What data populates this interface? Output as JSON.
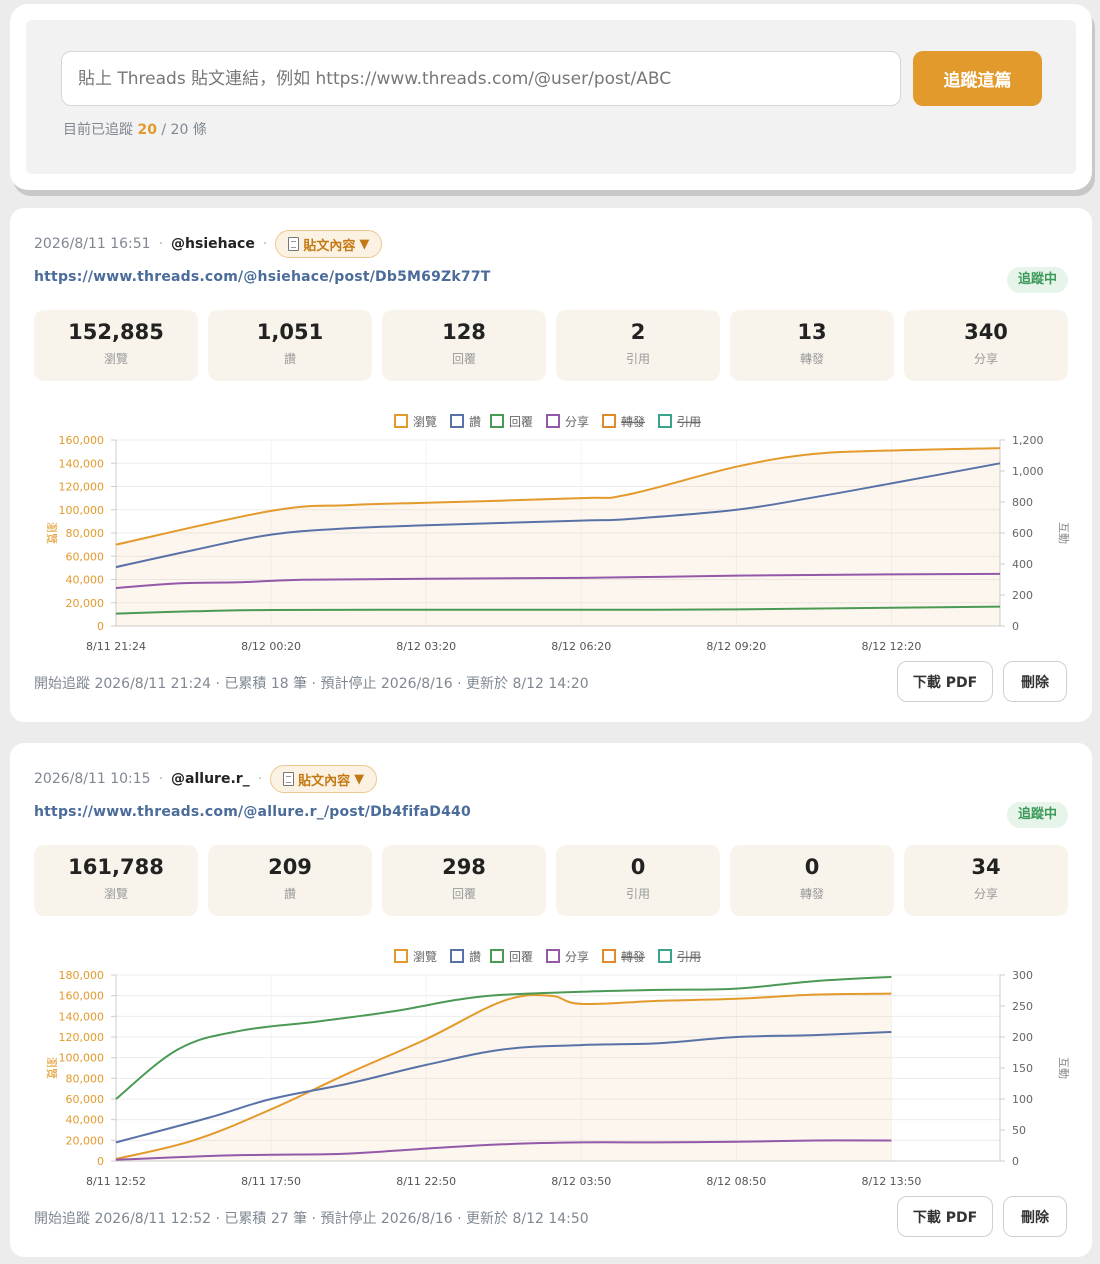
{
  "tracker": {
    "placeholder": "貼上 Threads 貼文連結，例如 https://www.threads.com/@user/post/ABC",
    "button_label": "追蹤這篇",
    "count_prefix": "目前已追蹤",
    "count_current": "20",
    "count_suffix": "/ 20 條"
  },
  "colors": {
    "views": "#e39a2c",
    "likes": "#5872a8",
    "replies": "#4a9a55",
    "shares": "#9358a8",
    "reposts": "#e08a2c",
    "quotes": "#3aa38c",
    "accent": "#e39a2c"
  },
  "posts": [
    {
      "date": "2026/8/11 16:51",
      "user": "@hsiehace",
      "content_label": "貼文內容",
      "url": "https://www.threads.com/@hsiehace/post/Db5M69Zk77T",
      "status": "追蹤中",
      "stats": [
        {
          "value": "152,885",
          "label": "瀏覽"
        },
        {
          "value": "1,051",
          "label": "讚"
        },
        {
          "value": "128",
          "label": "回覆"
        },
        {
          "value": "2",
          "label": "引用"
        },
        {
          "value": "13",
          "label": "轉發"
        },
        {
          "value": "340",
          "label": "分享"
        }
      ],
      "footer": "開始追蹤 2026/8/11 21:24 · 已累積 18 筆 · 預計停止 2026/8/16 · 更新於 8/12 14:20",
      "pdf_label": "下載 PDF",
      "delete_label": "刪除"
    },
    {
      "date": "2026/8/11 10:15",
      "user": "@allure.r_",
      "content_label": "貼文內容",
      "url": "https://www.threads.com/@allure.r_/post/Db4fifaD440",
      "status": "追蹤中",
      "stats": [
        {
          "value": "161,788",
          "label": "瀏覽"
        },
        {
          "value": "209",
          "label": "讚"
        },
        {
          "value": "298",
          "label": "回覆"
        },
        {
          "value": "0",
          "label": "引用"
        },
        {
          "value": "0",
          "label": "轉發"
        },
        {
          "value": "34",
          "label": "分享"
        }
      ],
      "footer": "開始追蹤 2026/8/11 12:52 · 已累積 27 筆 · 預計停止 2026/8/16 · 更新於 8/12 14:50",
      "pdf_label": "下載 PDF",
      "delete_label": "刪除"
    }
  ],
  "chart_data": [
    {
      "type": "line",
      "x": [
        "8/11 21:24",
        "8/12 00:20",
        "8/12 03:20",
        "8/12 06:20",
        "8/12 09:20",
        "8/12 12:20"
      ],
      "xlabel": "",
      "ylabel": "瀏覽",
      "y2label": "互動",
      "ylim": [
        0,
        160000
      ],
      "y2lim": [
        0,
        1200
      ],
      "yticks": [
        "0",
        "20,000",
        "40,000",
        "60,000",
        "80,000",
        "100,000",
        "120,000",
        "140,000",
        "160,000"
      ],
      "y2ticks": [
        "0",
        "200",
        "400",
        "600",
        "800",
        "1,000",
        "1,200"
      ],
      "legend": [
        {
          "name": "瀏覽",
          "hidden": false
        },
        {
          "name": "讚",
          "hidden": false
        },
        {
          "name": "回覆",
          "hidden": false
        },
        {
          "name": "分享",
          "hidden": false
        },
        {
          "name": "轉發",
          "hidden": true
        },
        {
          "name": "引用",
          "hidden": true
        }
      ],
      "legend_position": "top",
      "grid": true,
      "series": [
        {
          "name": "瀏覽",
          "axis": "left",
          "points": [
            [
              0,
              70000
            ],
            [
              1,
              99000
            ],
            [
              1.5,
              104000
            ],
            [
              2,
              106000
            ],
            [
              3,
              110000
            ],
            [
              3.3,
              113000
            ],
            [
              4,
              137000
            ],
            [
              4.5,
              148000
            ],
            [
              5,
              151000
            ],
            [
              5.7,
              153000
            ]
          ]
        },
        {
          "name": "讚",
          "axis": "right",
          "points": [
            [
              0,
              380
            ],
            [
              0.5,
              490
            ],
            [
              1,
              590
            ],
            [
              1.5,
              630
            ],
            [
              2,
              650
            ],
            [
              3,
              680
            ],
            [
              3.3,
              690
            ],
            [
              4,
              750
            ],
            [
              4.5,
              830
            ],
            [
              5,
              920
            ],
            [
              5.7,
              1050
            ]
          ]
        },
        {
          "name": "回覆",
          "axis": "right",
          "points": [
            [
              0,
              80
            ],
            [
              0.5,
              95
            ],
            [
              1,
              103
            ],
            [
              2,
              105
            ],
            [
              3,
              105
            ],
            [
              4,
              107
            ],
            [
              5,
              118
            ],
            [
              5.7,
              125
            ]
          ]
        },
        {
          "name": "分享",
          "axis": "right",
          "points": [
            [
              0,
              245
            ],
            [
              0.4,
              275
            ],
            [
              0.8,
              282
            ],
            [
              1.2,
              298
            ],
            [
              2,
              305
            ],
            [
              3,
              310
            ],
            [
              4,
              325
            ],
            [
              5,
              333
            ],
            [
              5.7,
              336
            ]
          ]
        }
      ]
    },
    {
      "type": "line",
      "x": [
        "8/11 12:52",
        "8/11 17:50",
        "8/11 22:50",
        "8/12 03:50",
        "8/12 08:50",
        "8/12 13:50"
      ],
      "xlabel": "",
      "ylabel": "瀏覽",
      "y2label": "互動",
      "ylim": [
        0,
        180000
      ],
      "y2lim": [
        0,
        300
      ],
      "yticks": [
        "0",
        "20,000",
        "40,000",
        "60,000",
        "80,000",
        "100,000",
        "120,000",
        "140,000",
        "160,000",
        "180,000"
      ],
      "y2ticks": [
        "0",
        "50",
        "100",
        "150",
        "200",
        "250",
        "300"
      ],
      "legend": [
        {
          "name": "瀏覽",
          "hidden": false
        },
        {
          "name": "讚",
          "hidden": false
        },
        {
          "name": "回覆",
          "hidden": false
        },
        {
          "name": "分享",
          "hidden": false
        },
        {
          "name": "轉發",
          "hidden": true
        },
        {
          "name": "引用",
          "hidden": true
        }
      ],
      "legend_position": "top",
      "grid": true,
      "series": [
        {
          "name": "瀏覽",
          "axis": "left",
          "points": [
            [
              0,
              2000
            ],
            [
              0.5,
              20000
            ],
            [
              1,
              50000
            ],
            [
              1.5,
              85000
            ],
            [
              2,
              118000
            ],
            [
              2.5,
              155000
            ],
            [
              2.8,
              160000
            ],
            [
              3,
              152000
            ],
            [
              3.5,
              155000
            ],
            [
              4,
              157000
            ],
            [
              4.5,
              161000
            ],
            [
              5,
              162000
            ]
          ]
        },
        {
          "name": "讚",
          "axis": "right",
          "points": [
            [
              0,
              30
            ],
            [
              0.6,
              70
            ],
            [
              1,
              100
            ],
            [
              1.5,
              125
            ],
            [
              2,
              155
            ],
            [
              2.5,
              180
            ],
            [
              3,
              187
            ],
            [
              3.5,
              190
            ],
            [
              4,
              200
            ],
            [
              4.5,
              203
            ],
            [
              5,
              208
            ]
          ]
        },
        {
          "name": "回覆",
          "axis": "right",
          "points": [
            [
              0,
              100
            ],
            [
              0.4,
              180
            ],
            [
              0.8,
              210
            ],
            [
              1.3,
              225
            ],
            [
              1.8,
              242
            ],
            [
              2.2,
              260
            ],
            [
              2.5,
              268
            ],
            [
              3,
              273
            ],
            [
              3.5,
              276
            ],
            [
              4,
              278
            ],
            [
              4.5,
              290
            ],
            [
              5,
              297
            ]
          ]
        },
        {
          "name": "分享",
          "axis": "right",
          "points": [
            [
              0,
              2
            ],
            [
              0.6,
              8
            ],
            [
              1,
              10
            ],
            [
              1.5,
              12
            ],
            [
              2,
              20
            ],
            [
              2.5,
              27
            ],
            [
              3,
              30
            ],
            [
              3.5,
              30
            ],
            [
              4,
              31
            ],
            [
              4.5,
              33
            ],
            [
              5,
              33
            ]
          ]
        }
      ]
    }
  ]
}
